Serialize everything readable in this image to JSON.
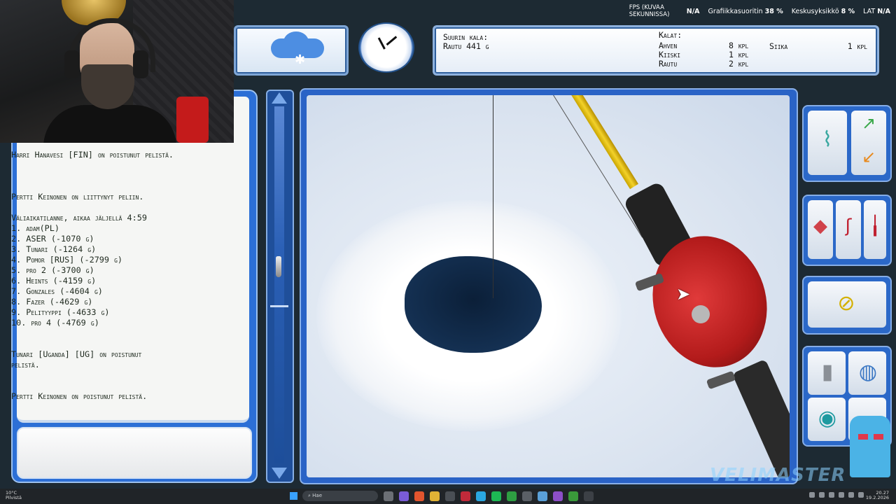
{
  "stats": {
    "fps_label": "FPS (KUVAA SEKUNNISSA)",
    "fps_value": "N/A",
    "gpu_label": "Grafiikkasuoritin",
    "gpu_value": "38 %",
    "cpu_label": "Keskusyksikkö",
    "cpu_value": "8 %",
    "lat_label": "LAT",
    "lat_value": "N/A"
  },
  "catch": {
    "biggest_label": "Suurin kala:",
    "biggest_value": "Rautu 441 g",
    "header": "Kalat:",
    "fish": [
      {
        "name": "Ahven",
        "count": "8 kpl"
      },
      {
        "name": "Kiiski",
        "count": "1 kpl"
      },
      {
        "name": "Rautu",
        "count": "2 kpl"
      }
    ],
    "side_fish": {
      "name": "Siika",
      "count": "1 kpl"
    }
  },
  "chat": {
    "lines": [
      "Harri Hanavesi [FIN] on poistunut pelistä.",
      "",
      "",
      "",
      "Pertti Keinonen on liittynyt peliin.",
      "",
      "Väliaikatilanne, aikaa jäljellä 4:59",
      "1. adam(PL)",
      "2. ASER (-1070 g)",
      "3. Tunari (-1264 g)",
      "4. Pomor [RUS] (-2799 g)",
      "5. pro 2 (-3700 g)",
      "6. Heints (-4159 g)",
      "7. Gonzales (-4604 g)",
      "8. Fazer (-4629 g)",
      "9. Pelityyppi (-4633 g)",
      "10. pro 4 (-4769 g)",
      "",
      "",
      "Tunari [Uganda] [UG] on poistunut",
      "pelistä.",
      "",
      "",
      "Pertti Keinonen on poistunut pelistä."
    ],
    "input_value": ""
  },
  "watermark": "VELIMASTER",
  "taskbar": {
    "weather": "10°C",
    "weather_desc": "Pilvistä",
    "search_placeholder": "Hae",
    "time": "20.27",
    "date": "19.2.2026"
  },
  "icons": {
    "weather": "cloud-snow-icon",
    "clock": "clock-icon",
    "drill": "ice-drill-icon",
    "lures": "lures-icon",
    "rod": "rod-icon",
    "flashlight": "flashlight-icon",
    "globe": "globe-icon",
    "eye": "eye-icon"
  }
}
